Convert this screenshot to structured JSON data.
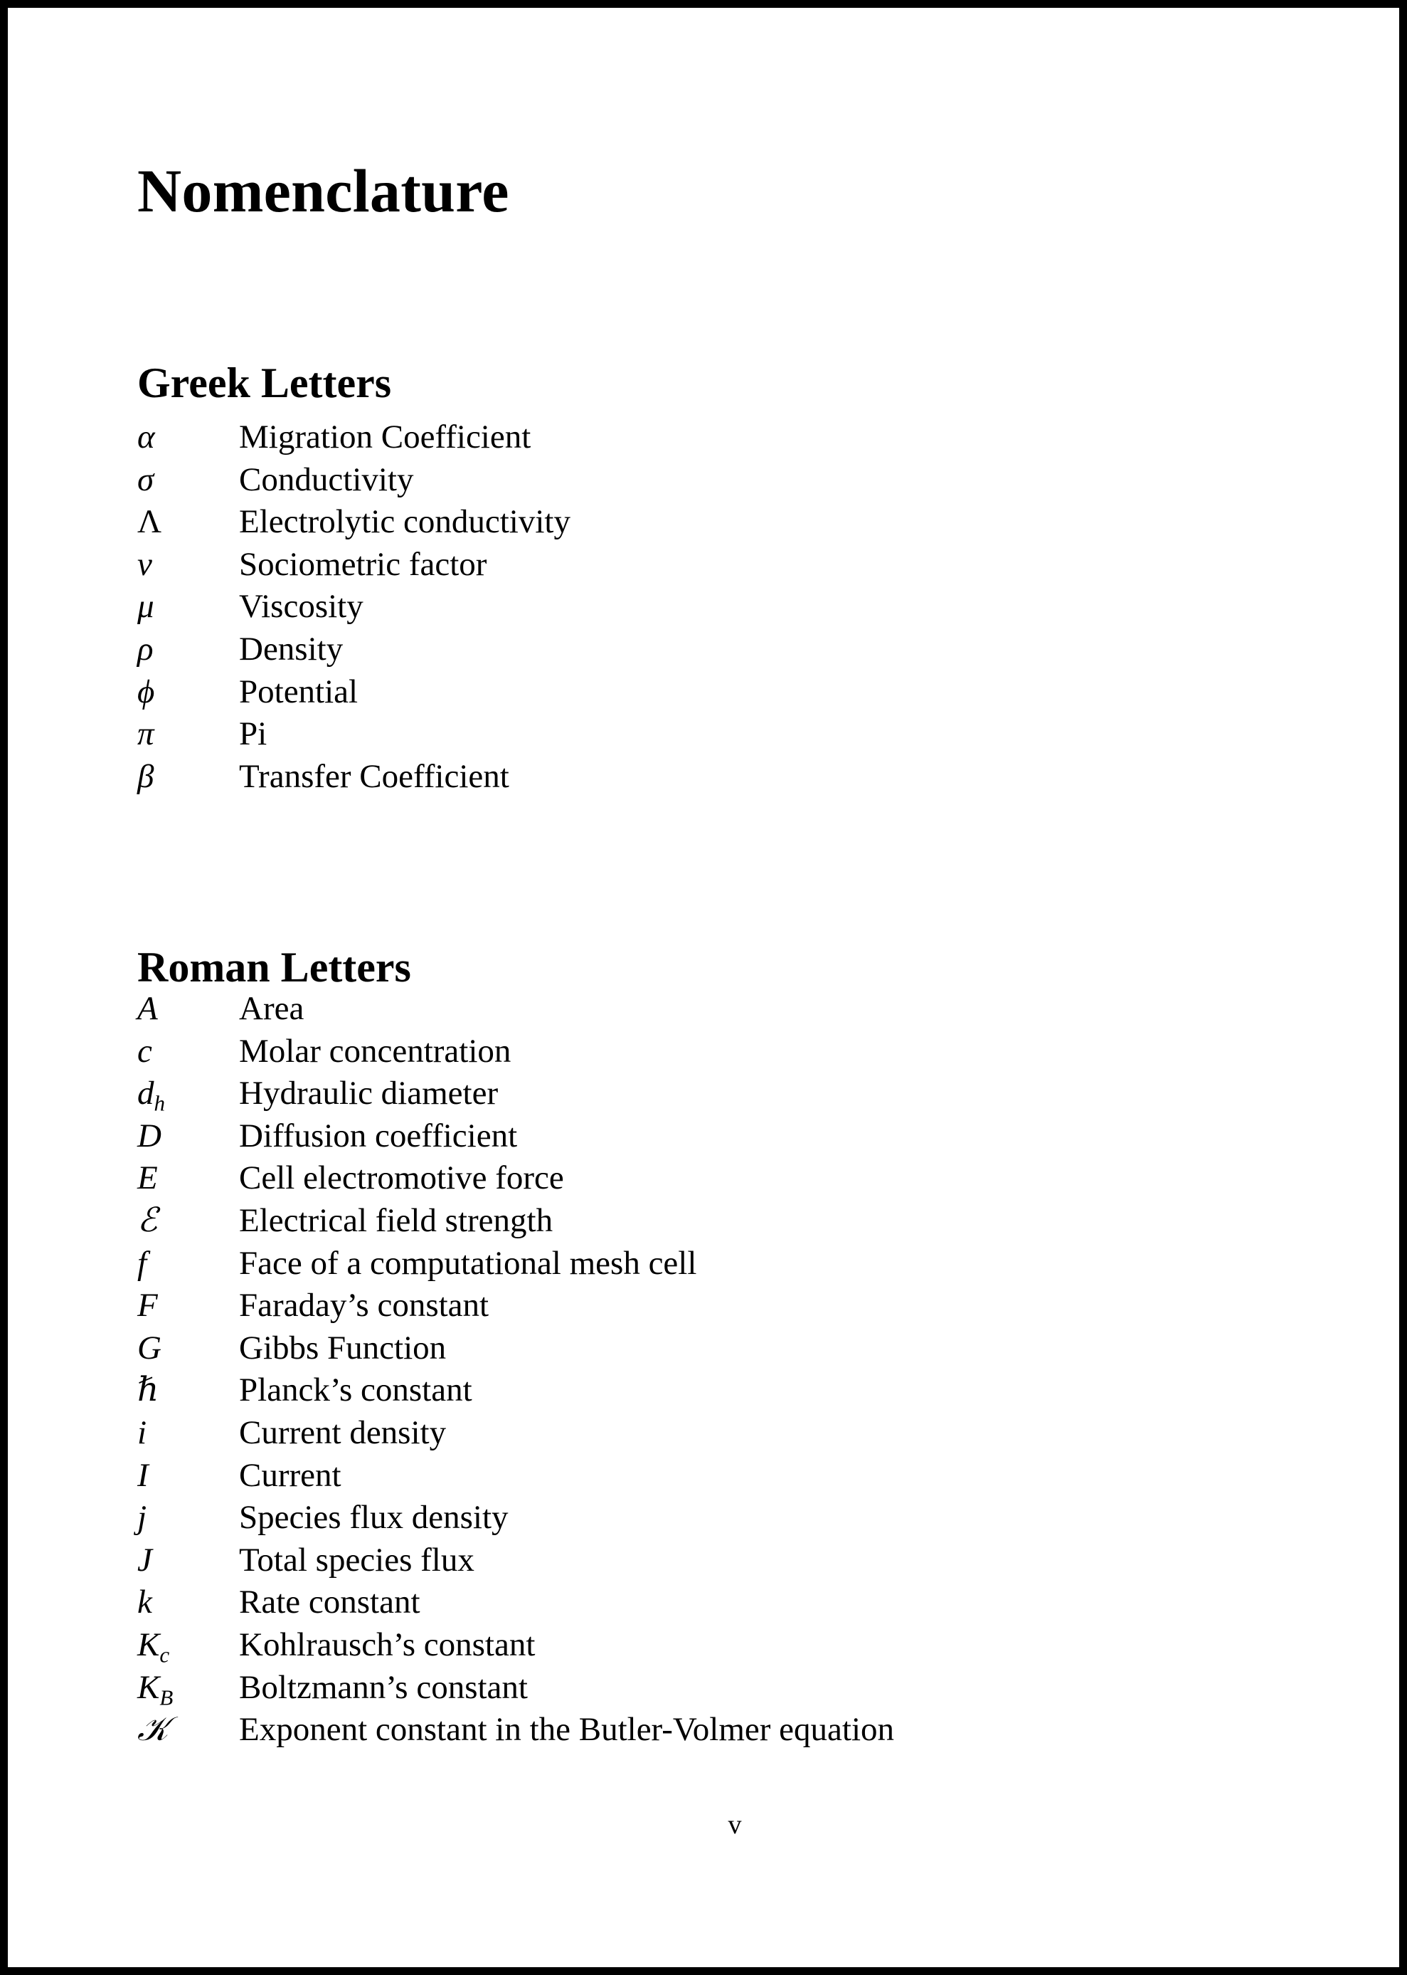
{
  "page": {
    "title": "Nomenclature",
    "page_number": "v",
    "border_color": "#000000",
    "background_color": "#ffffff",
    "text_color": "#000000"
  },
  "sections": [
    {
      "id": "greek",
      "heading": "Greek Letters",
      "entries": [
        {
          "symbol": "α",
          "sub": "",
          "style": "italic",
          "description": "Migration Coefficient"
        },
        {
          "symbol": "σ",
          "sub": "",
          "style": "italic",
          "description": "Conductivity"
        },
        {
          "symbol": "Λ",
          "sub": "",
          "style": "upright",
          "description": "Electrolytic conductivity"
        },
        {
          "symbol": "ν",
          "sub": "",
          "style": "italic",
          "description": "Sociometric factor"
        },
        {
          "symbol": "μ",
          "sub": "",
          "style": "italic",
          "description": "Viscosity"
        },
        {
          "symbol": "ρ",
          "sub": "",
          "style": "italic",
          "description": "Density"
        },
        {
          "symbol": "ϕ",
          "sub": "",
          "style": "italic",
          "description": "Potential"
        },
        {
          "symbol": "π",
          "sub": "",
          "style": "italic",
          "description": "Pi"
        },
        {
          "symbol": "β",
          "sub": "",
          "style": "italic",
          "description": "Transfer Coefficient"
        }
      ]
    },
    {
      "id": "roman",
      "heading": "Roman Letters",
      "entries": [
        {
          "symbol": "A",
          "sub": "",
          "style": "italic",
          "description": "Area"
        },
        {
          "symbol": "c",
          "sub": "",
          "style": "italic",
          "description": "Molar concentration"
        },
        {
          "symbol": "d",
          "sub": "h",
          "style": "italic",
          "description": "Hydraulic diameter"
        },
        {
          "symbol": "D",
          "sub": "",
          "style": "italic",
          "description": "Diffusion coefficient"
        },
        {
          "symbol": "E",
          "sub": "",
          "style": "italic",
          "description": "Cell electromotive force"
        },
        {
          "symbol": "ℰ",
          "sub": "",
          "style": "script",
          "description": "Electrical field strength"
        },
        {
          "symbol": "f",
          "sub": "",
          "style": "italic",
          "description": "Face of a computational mesh cell"
        },
        {
          "symbol": "F",
          "sub": "",
          "style": "italic",
          "description": "Faraday’s constant"
        },
        {
          "symbol": "G",
          "sub": "",
          "style": "italic",
          "description": "Gibbs Function"
        },
        {
          "symbol": "ℏ",
          "sub": "",
          "style": "italic",
          "description": "Planck’s constant"
        },
        {
          "symbol": "i",
          "sub": "",
          "style": "italic",
          "description": "Current density"
        },
        {
          "symbol": "I",
          "sub": "",
          "style": "italic",
          "description": "Current"
        },
        {
          "symbol": "j",
          "sub": "",
          "style": "italic",
          "description": "Species flux density"
        },
        {
          "symbol": "J",
          "sub": "",
          "style": "italic",
          "description": "Total species flux"
        },
        {
          "symbol": "k",
          "sub": "",
          "style": "italic",
          "description": "Rate constant"
        },
        {
          "symbol": "K",
          "sub": "c",
          "style": "italic",
          "description": "Kohlrausch’s constant"
        },
        {
          "symbol": "K",
          "sub": "B",
          "style": "italic",
          "description": "Boltzmann’s constant"
        },
        {
          "symbol": "𝒦",
          "sub": "",
          "style": "script",
          "description": "Exponent constant in the Butler-Volmer equation"
        }
      ]
    }
  ]
}
